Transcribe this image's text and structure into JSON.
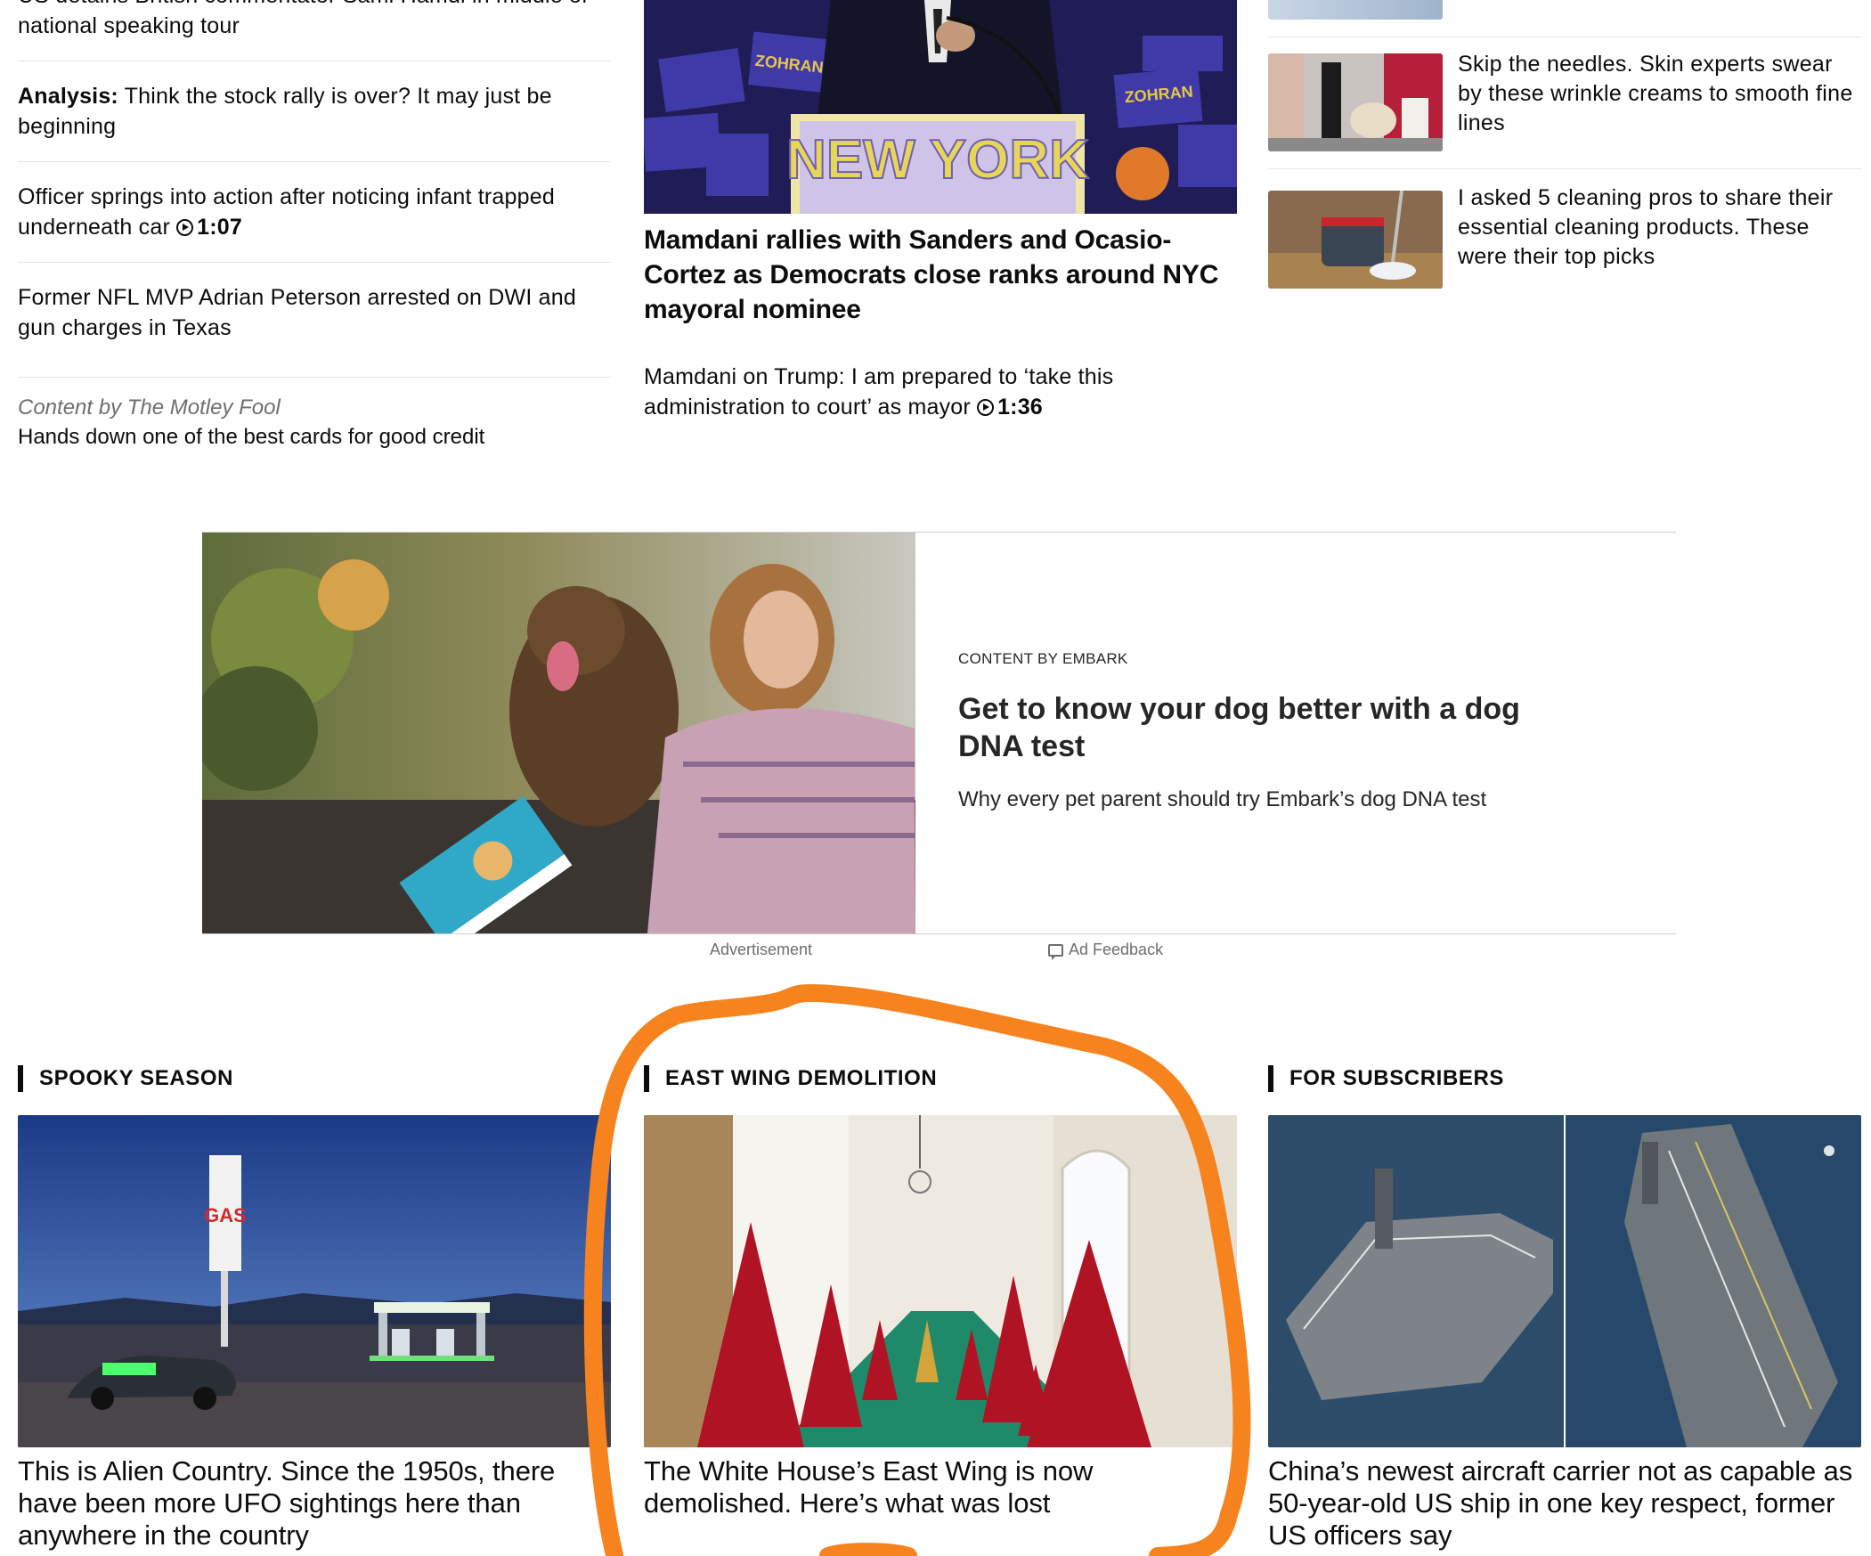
{
  "left_list": [
    {
      "prefix": "",
      "text": "US detains British commentator Sami Hamdi in middle of national speaking tour",
      "duration": ""
    },
    {
      "prefix": "Analysis:",
      "text": " Think the stock rally is over? It may just be beginning",
      "duration": ""
    },
    {
      "prefix": "",
      "text": "Officer springs into action after noticing infant trapped underneath car ",
      "duration": "1:07"
    },
    {
      "prefix": "",
      "text": "Former NFL MVP Adrian Peterson arrested on DWI and gun charges in Texas",
      "duration": ""
    }
  ],
  "left_sponsor": {
    "label": "Content by The Motley Fool",
    "headline": "Hands down one of the best cards for good credit"
  },
  "middle": {
    "sign_text": "NEW YORK",
    "crowd_sign": "ZOHRAN",
    "headline": "Mamdani rallies with Sanders and Ocasio-Cortez as Democrats close ranks around NYC mayoral nominee",
    "sub_headline": "Mamdani on Trump: I am prepared to ‘take this administration to court’ as mayor ",
    "sub_duration": "1:36"
  },
  "right_list": [
    {
      "text": "Skip the needles. Skin experts swear by these wrinkle creams to smooth fine lines"
    },
    {
      "text": "I asked 5 cleaning pros to share their essential cleaning products. These were their top picks"
    }
  ],
  "ad": {
    "kicker": "CONTENT BY EMBARK",
    "title": "Get to know your dog better with a dog DNA test",
    "description": "Why every pet parent should try Embark’s dog DNA test",
    "footer_left": "Advertisement",
    "footer_right": "Ad Feedback"
  },
  "cards": [
    {
      "label": "SPOOKY SEASON",
      "title": "This is Alien Country. Since the 1950s, there have been more UFO sightings here than anywhere in the country",
      "sign": "GAS"
    },
    {
      "label": "EAST WING DEMOLITION",
      "title": "The White House’s East Wing is now demolished. Here’s what was lost"
    },
    {
      "label": "FOR SUBSCRIBERS",
      "title": "China’s newest aircraft carrier not as capable as 50-year-old US ship in one key respect, former US officers say"
    }
  ],
  "colors": {
    "annotation": "#f7831f",
    "text": "#0c0c0c",
    "muted": "#6e6e6e"
  }
}
